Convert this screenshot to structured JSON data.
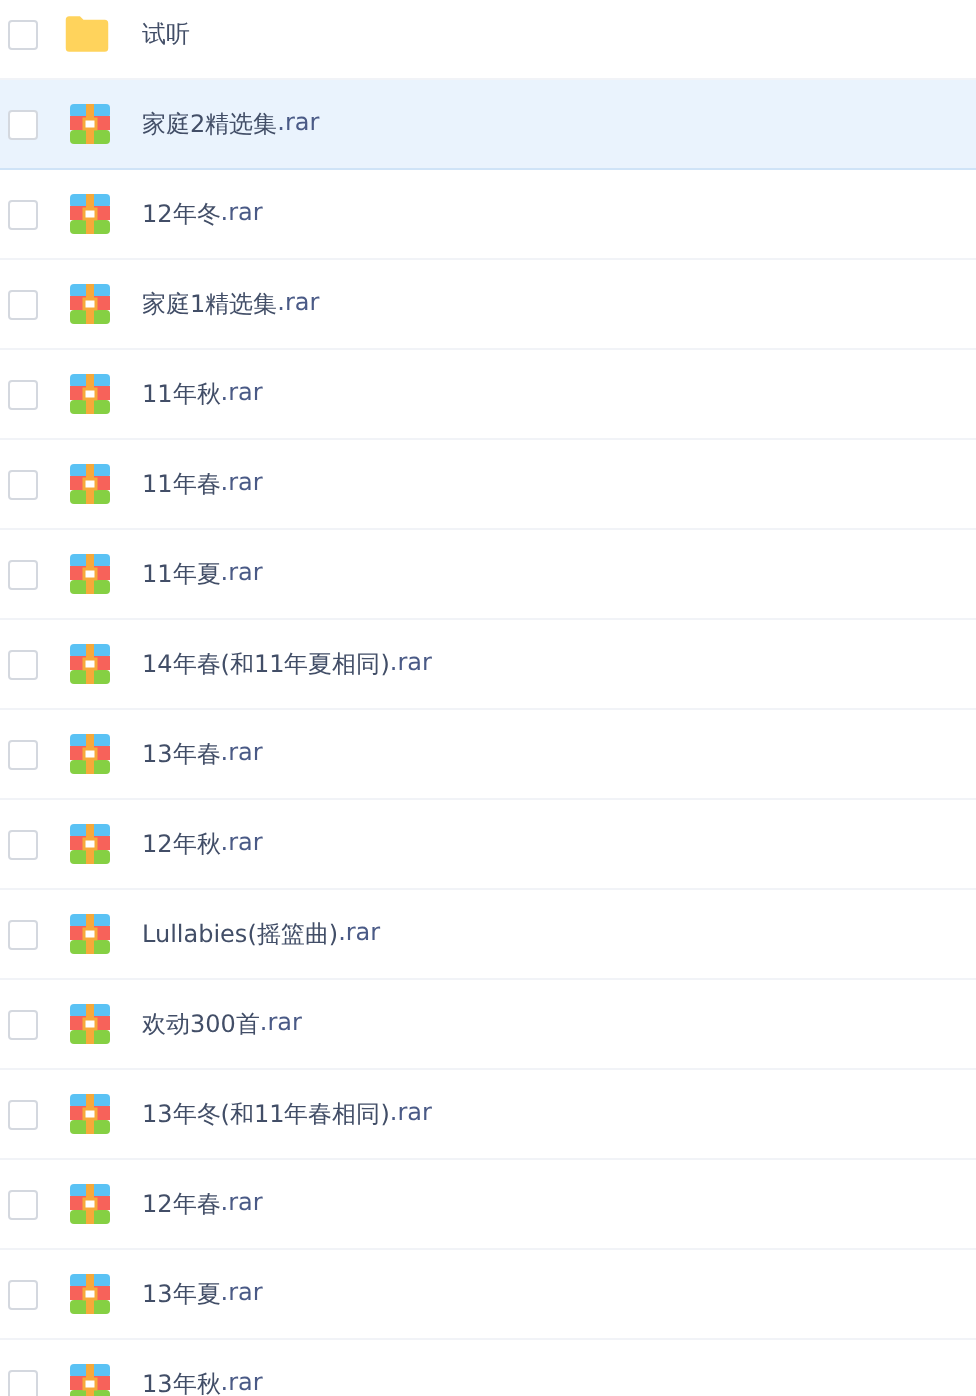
{
  "files": [
    {
      "kind": "folder",
      "name": "试听",
      "checked": false,
      "highlighted": false
    },
    {
      "kind": "archive",
      "name": "家庭2精选集",
      "extension": ".rar",
      "checked": false,
      "highlighted": true
    },
    {
      "kind": "archive",
      "name": "12年冬",
      "extension": ".rar",
      "checked": false,
      "highlighted": false
    },
    {
      "kind": "archive",
      "name": "家庭1精选集",
      "extension": ".rar",
      "checked": false,
      "highlighted": false
    },
    {
      "kind": "archive",
      "name": "11年秋",
      "extension": ".rar",
      "checked": false,
      "highlighted": false
    },
    {
      "kind": "archive",
      "name": "11年春",
      "extension": ".rar",
      "checked": false,
      "highlighted": false
    },
    {
      "kind": "archive",
      "name": "11年夏",
      "extension": ".rar",
      "checked": false,
      "highlighted": false
    },
    {
      "kind": "archive",
      "name": "14年春(和11年夏相同)",
      "extension": ".rar",
      "checked": false,
      "highlighted": false
    },
    {
      "kind": "archive",
      "name": "13年春",
      "extension": ".rar",
      "checked": false,
      "highlighted": false
    },
    {
      "kind": "archive",
      "name": "12年秋",
      "extension": ".rar",
      "checked": false,
      "highlighted": false
    },
    {
      "kind": "archive",
      "name": "Lullabies(摇篮曲)",
      "extension": ".rar",
      "checked": false,
      "highlighted": false
    },
    {
      "kind": "archive",
      "name": "欢动300首",
      "extension": ".rar",
      "checked": false,
      "highlighted": false
    },
    {
      "kind": "archive",
      "name": "13年冬(和11年春相同)",
      "extension": ".rar",
      "checked": false,
      "highlighted": false
    },
    {
      "kind": "archive",
      "name": "12年春",
      "extension": ".rar",
      "checked": false,
      "highlighted": false
    },
    {
      "kind": "archive",
      "name": "13年夏",
      "extension": ".rar",
      "checked": false,
      "highlighted": false
    },
    {
      "kind": "archive",
      "name": "13年秋",
      "extension": ".rar",
      "checked": false,
      "highlighted": false
    }
  ]
}
